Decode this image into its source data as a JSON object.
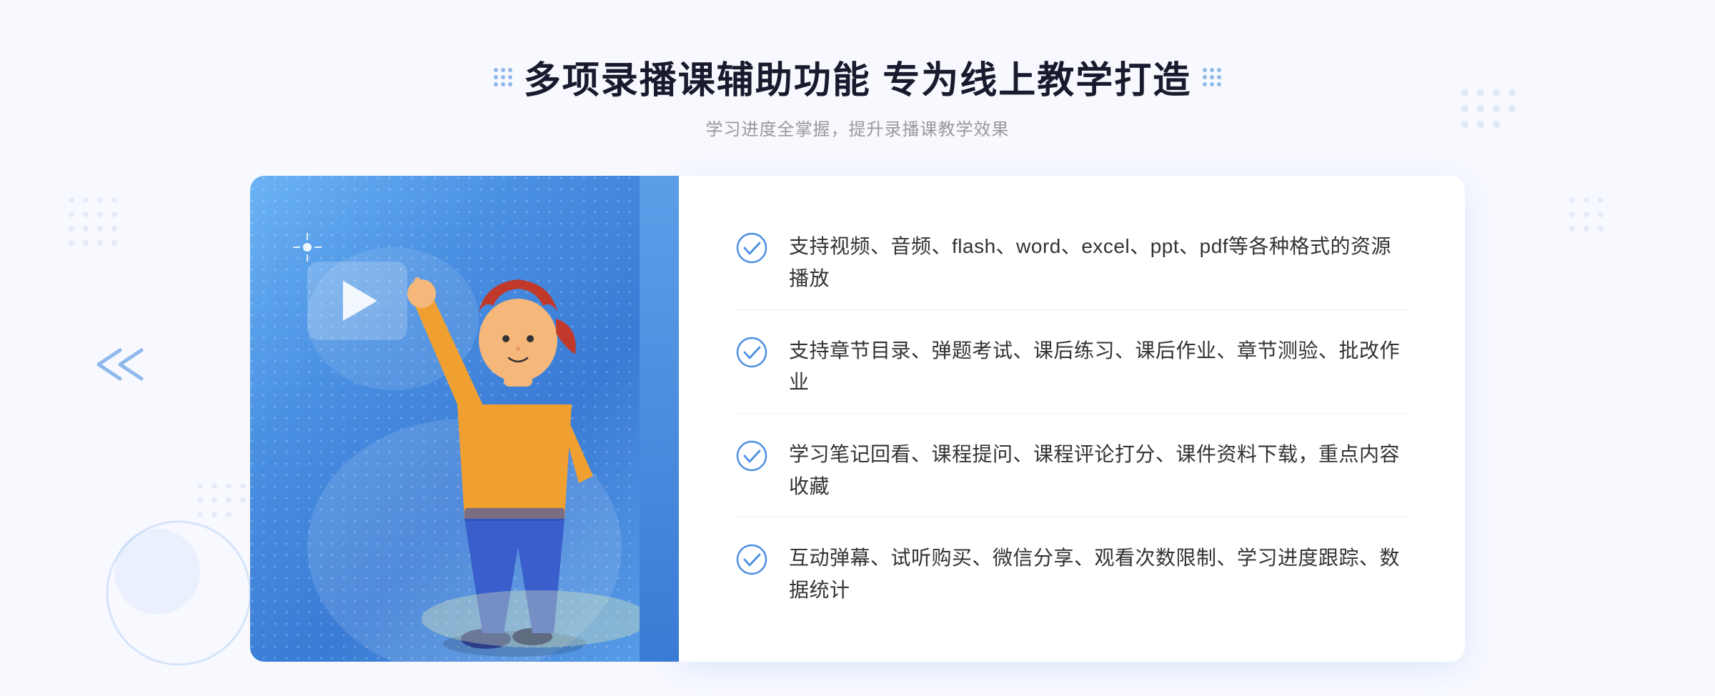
{
  "page": {
    "background": "#f5f7ff"
  },
  "header": {
    "title": "多项录播课辅助功能 专为线上教学打造",
    "subtitle": "学习进度全掌握，提升录播课教学效果",
    "icon_left": "grid-dots",
    "icon_right": "grid-dots"
  },
  "features": [
    {
      "id": 1,
      "text": "支持视频、音频、flash、word、excel、ppt、pdf等各种格式的资源播放"
    },
    {
      "id": 2,
      "text": "支持章节目录、弹题考试、课后练习、课后作业、章节测验、批改作业"
    },
    {
      "id": 3,
      "text": "学习笔记回看、课程提问、课程评论打分、课件资料下载，重点内容收藏"
    },
    {
      "id": 4,
      "text": "互动弹幕、试听购买、微信分享、观看次数限制、学习进度跟踪、数据统计"
    }
  ],
  "colors": {
    "accent_blue": "#4a90e2",
    "light_blue": "#6bb3f5",
    "dark_blue": "#3a7bd5",
    "text_dark": "#1a1a2e",
    "text_gray": "#999999",
    "text_feature": "#333333",
    "check_color": "#4a90e2",
    "panel_bg": "#ffffff"
  }
}
